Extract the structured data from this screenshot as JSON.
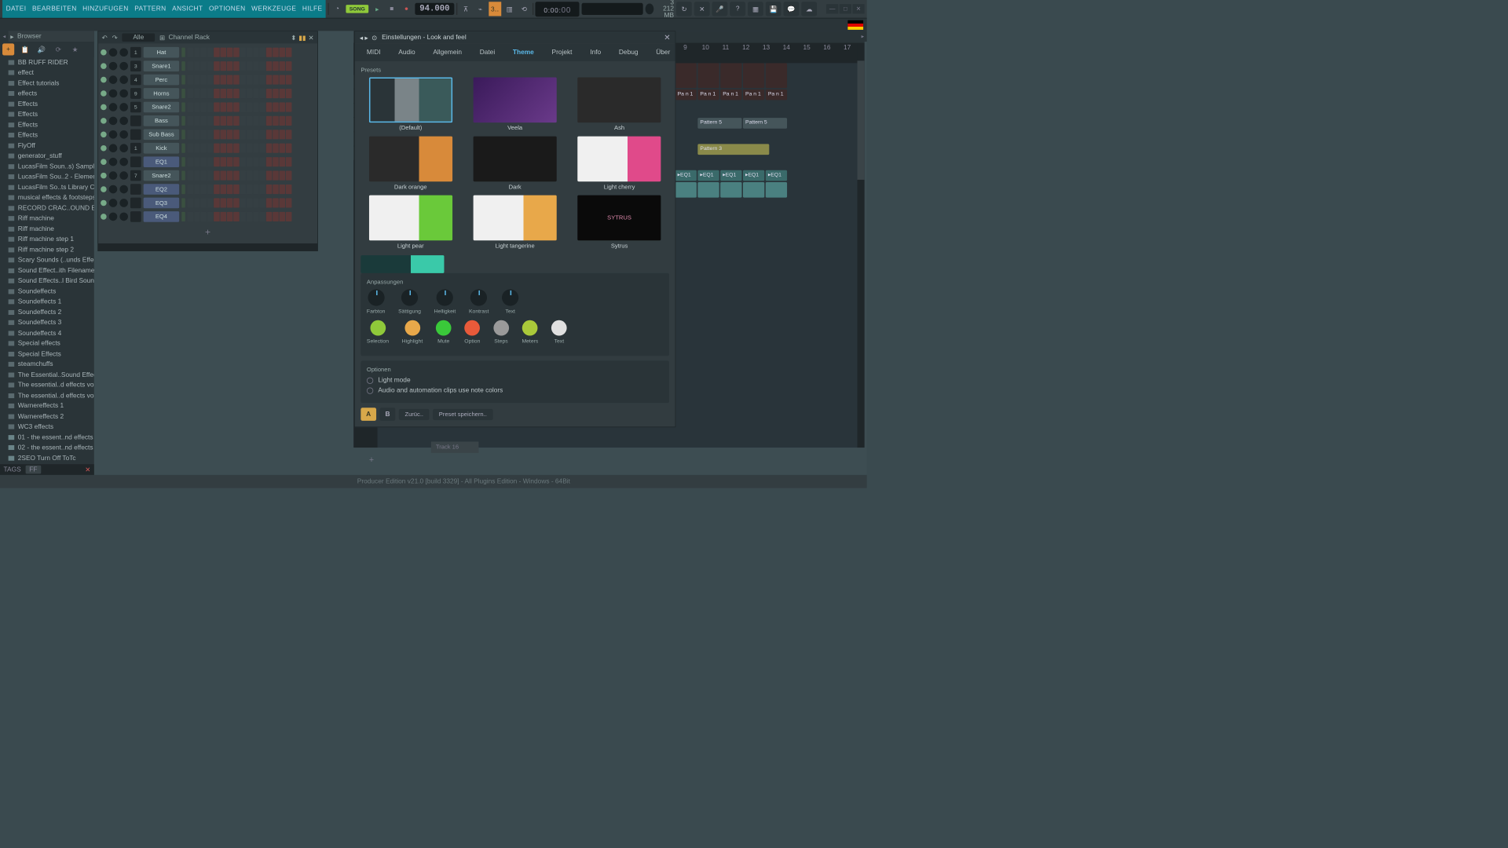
{
  "menu": [
    "DATEI",
    "BEARBEITEN",
    "HINZUFUGEN",
    "PATTERN",
    "ANSICHT",
    "OPTIONEN",
    "WERKZEUGE",
    "HILFE"
  ],
  "transport": {
    "song": "SONG",
    "tempo": "94.000",
    "time_main": "0:00:",
    "time_fine": "00"
  },
  "cpu": {
    "num": "3",
    "mem": "212 MB"
  },
  "browser": {
    "title": "Browser",
    "items": [
      "BB RUFF RIDER",
      "effect",
      "Effect tutorials",
      "effects",
      "Effects",
      "Effects",
      "Effects",
      "Effects",
      "FlyOff",
      "generator_stuff",
      "LucasFilm Soun..s) Sampling",
      "LucasFilm Sou..2 - Elements",
      "LucasFilm So..ts Library CD3",
      "musical effects & footsteps",
      "RECORD CRAC..OUND EFFECT",
      "Riff machine",
      "Riff machine",
      "Riff machine step 1",
      "Riff machine step 2",
      "Scary Sounds (..unds Effects)",
      "Sound Effect..ith Filenames)",
      "Sound Effects..l Bird Sounds",
      "Soundeffects",
      "Soundeffects 1",
      "Soundeffects 2",
      "Soundeffects 3",
      "Soundeffects 4",
      "Special effects",
      "Special Effects",
      "steamchuffs",
      "The Essential..Sound Effects",
      "The essential..d effects vol.1",
      "The essential..d effects vol.2",
      "Warnereffects 1",
      "Warnereffects 2",
      "WC3 effects"
    ],
    "files": [
      "01 - the essent..nd effects vol.2",
      "02 - the essent..nd effects vol.2",
      "2SEO Turn Off ToTc"
    ],
    "tags_label": "TAGS",
    "tags_val": "FF"
  },
  "rack": {
    "filter": "Alle",
    "title": "Channel Rack",
    "channels": [
      {
        "n": "1",
        "name": "Hat"
      },
      {
        "n": "3",
        "name": "Snare1"
      },
      {
        "n": "4",
        "name": "Perc"
      },
      {
        "n": "9",
        "name": "Horns"
      },
      {
        "n": "5",
        "name": "Snare2"
      },
      {
        "n": "",
        "name": "Bass"
      },
      {
        "n": "",
        "name": "Sub Bass"
      },
      {
        "n": "1",
        "name": "Kick"
      },
      {
        "n": "",
        "name": "EQ1",
        "eq": true
      },
      {
        "n": "7",
        "name": "Snare2"
      },
      {
        "n": "",
        "name": "EQ2",
        "eq": true
      },
      {
        "n": "",
        "name": "EQ3",
        "eq": true
      },
      {
        "n": "",
        "name": "EQ4",
        "eq": true
      }
    ]
  },
  "playlist": {
    "patterns": [
      "Patt",
      "Patt",
      "Patt",
      "Patt",
      "Patt",
      "Patt"
    ],
    "ruler": [
      "9",
      "10",
      "11",
      "12",
      "13",
      "14",
      "15",
      "16",
      "17"
    ],
    "clips_pan": [
      "Pa n 1",
      "Pa n 1",
      "Pa n 1",
      "Pa n 1",
      "Pa n 1"
    ],
    "clips_pat5": [
      "Pattern 5",
      "Pattern 5"
    ],
    "clip_pat3": "Pattern 3",
    "clips_eq": [
      "EQ1",
      "EQ1",
      "EQ1",
      "EQ1",
      "EQ1"
    ],
    "track16": "Track 16"
  },
  "settings": {
    "title": "Einstellungen - Look and feel",
    "tabs": [
      "MIDI",
      "Audio",
      "Allgemein",
      "Datei",
      "Theme",
      "Projekt",
      "Info",
      "Debug",
      "Über"
    ],
    "active_tab": 4,
    "presets_label": "Presets",
    "presets": [
      "(Default)",
      "Veela",
      "Ash",
      "Dark orange",
      "Dark",
      "Light cherry",
      "Light pear",
      "Light tangerine",
      "Sytrus"
    ],
    "adj_label": "Anpassungen",
    "knobs": [
      "Farbton",
      "Sättigung",
      "Helligkeit",
      "Kontrast",
      "Text"
    ],
    "colors": [
      {
        "name": "Selection",
        "hex": "#8fc93a"
      },
      {
        "name": "Highlight",
        "hex": "#e8a84a"
      },
      {
        "name": "Mute",
        "hex": "#3ac93a"
      },
      {
        "name": "Option",
        "hex": "#e85a3a"
      },
      {
        "name": "Steps",
        "hex": "#9a9a9a"
      },
      {
        "name": "Meters",
        "hex": "#aac93a"
      },
      {
        "name": "Text",
        "hex": "#e0e0e0"
      }
    ],
    "opt_label": "Optionen",
    "opts": [
      "Light mode",
      "Audio and automation clips use note colors"
    ],
    "ab_a": "A",
    "ab_b": "B",
    "reset": "Zurüc..",
    "save": "Preset speichern.."
  },
  "status": "Producer Edition v21.0 [build 3329] - All Plugins Edition - Windows - 64Bit"
}
